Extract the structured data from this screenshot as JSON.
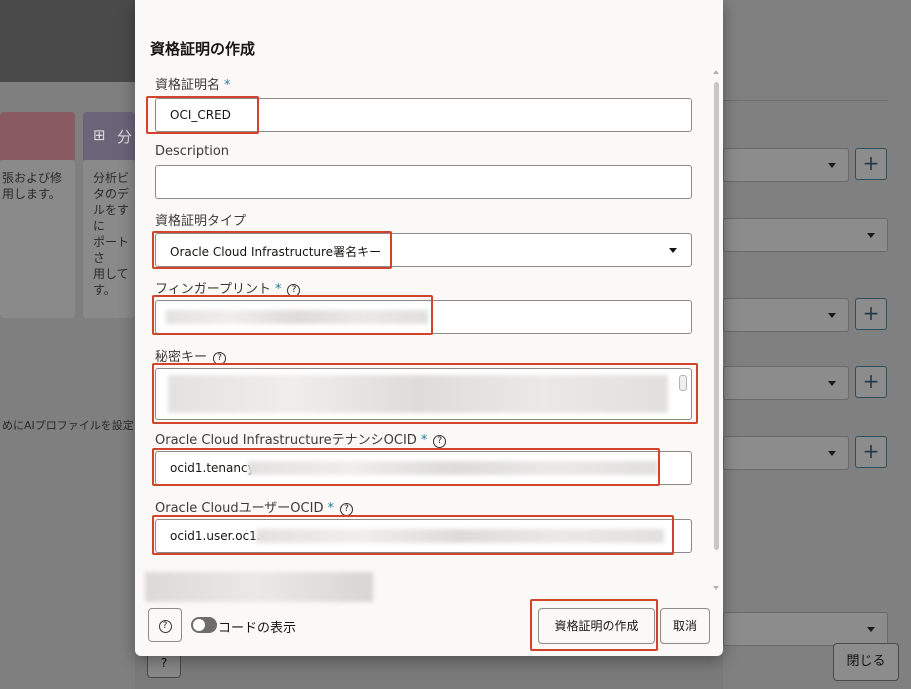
{
  "background": {
    "card1_text": "張および修\n用します。",
    "card2_label": "分",
    "card2_text": "分析ビ\nタのデ\nルをすに\nポートさ\n用して\nす。",
    "profile_text": "めにAIプロファイルを設定し",
    "close_label": "閉じる",
    "help_label": "?",
    "plus_label": "+"
  },
  "dialog": {
    "title": "資格証明の作成",
    "credential_name": {
      "label": "資格証明名",
      "required_mark": "*",
      "value": "OCI_CRED"
    },
    "description": {
      "label": "Description",
      "value": ""
    },
    "credential_type": {
      "label": "資格証明タイプ",
      "value": "Oracle Cloud Infrastructure署名キー"
    },
    "fingerprint": {
      "label": "フィンガープリント",
      "required_mark": "*",
      "help": "?"
    },
    "private_key": {
      "label": "秘密キー",
      "help": "?"
    },
    "tenancy_ocid": {
      "label": "Oracle Cloud InfrastructureテナンシOCID",
      "required_mark": "*",
      "help": "?",
      "value": "ocid1.tenancy."
    },
    "user_ocid": {
      "label": "Oracle CloudユーザーOCID",
      "required_mark": "*",
      "help": "?",
      "value": "ocid1.user.oc1."
    },
    "footer": {
      "help": "?",
      "show_code_label": "コードの表示",
      "create_button": "資格証明の作成",
      "cancel_button": "取消"
    }
  },
  "colors": {
    "highlight": "#d1442b",
    "required": "#227e9e"
  }
}
